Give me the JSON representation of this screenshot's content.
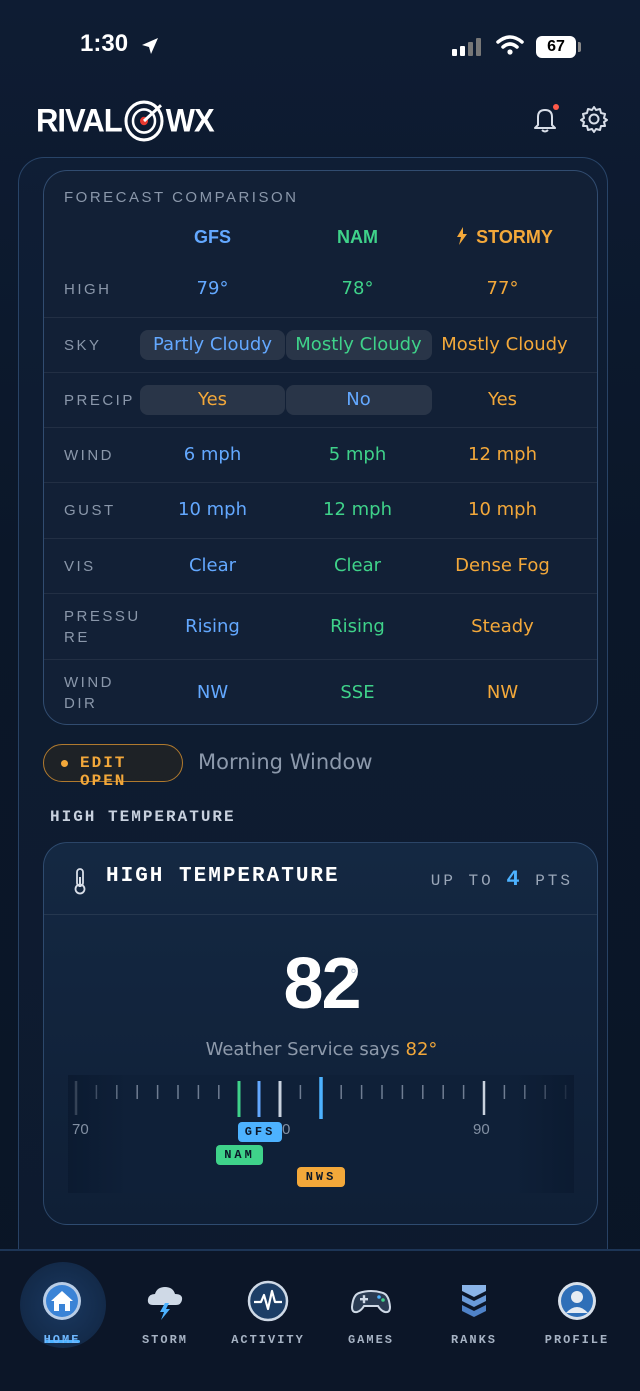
{
  "status_bar": {
    "time": "1:30",
    "battery": "67"
  },
  "header": {
    "logo_left": "RIVAL",
    "logo_right": "WX"
  },
  "comparison": {
    "title": "FORECAST COMPARISON",
    "columns": [
      "GFS",
      "NAM",
      "STORMY"
    ],
    "rows": [
      {
        "label": "HIGH",
        "values": [
          "79°",
          "78°",
          "77°"
        ]
      },
      {
        "label": "SKY",
        "values": [
          "Partly Cloudy",
          "Mostly Cloudy",
          "Mostly Cloudy"
        ]
      },
      {
        "label": "PRECIP",
        "values": [
          "Yes",
          "No",
          "Yes"
        ]
      },
      {
        "label": "WIND",
        "values": [
          "6 mph",
          "5 mph",
          "12 mph"
        ]
      },
      {
        "label": "GUST",
        "values": [
          "10 mph",
          "12 mph",
          "10 mph"
        ]
      },
      {
        "label": "VIS",
        "values": [
          "Clear",
          "Clear",
          "Dense Fog"
        ]
      },
      {
        "label": "PRESSURE",
        "values": [
          "Rising",
          "Rising",
          "Steady"
        ]
      },
      {
        "label": "WIND DIR",
        "values": [
          "NW",
          "SSE",
          "NW"
        ]
      }
    ]
  },
  "edit": {
    "status": "EDIT OPEN",
    "window": "Morning Window"
  },
  "section_label": "HIGH TEMPERATURE",
  "high_temp": {
    "title": "HIGH TEMPERATURE",
    "pts_prefix": "UP TO",
    "pts_value": "4",
    "pts_suffix": "PTS",
    "value": "82",
    "deg": "°",
    "ws_prefix": "Weather Service says",
    "ws_value": "82°",
    "ruler_label_left": "70",
    "ruler_label_mid": "0",
    "ruler_label_right": "90",
    "tags": {
      "gfs": "GFS",
      "nam": "NAM",
      "nws": "NWS"
    }
  },
  "nav": [
    {
      "label": "HOME",
      "active": true
    },
    {
      "label": "STORM"
    },
    {
      "label": "ACTIVITY"
    },
    {
      "label": "GAMES"
    },
    {
      "label": "RANKS"
    },
    {
      "label": "PROFILE"
    }
  ],
  "colors": {
    "gfs": "#63a8ff",
    "nam": "#3fd28a",
    "stormy": "#f3a83a",
    "accent": "#4db2ff"
  }
}
